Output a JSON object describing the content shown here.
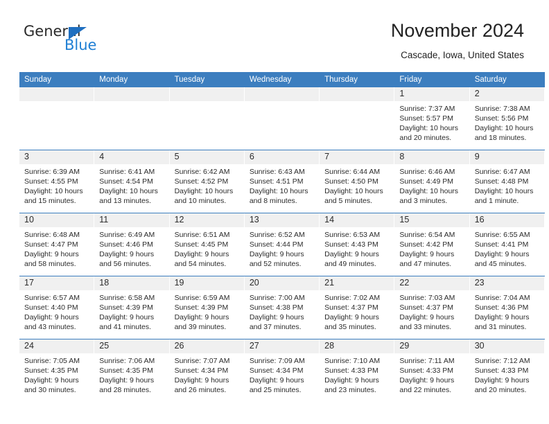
{
  "brand": {
    "name_top": "General",
    "name_bottom": "Blue",
    "triangle_icon": "triangle-icon",
    "accent_color": "#1f7fd4"
  },
  "header": {
    "title": "November 2024",
    "subtitle": "Cascade, Iowa, United States"
  },
  "theme": {
    "header_blue": "#3c7ebf",
    "daynum_gray": "#f0f0f0",
    "text": "#2b2b2b"
  },
  "weekday_headers": [
    "Sunday",
    "Monday",
    "Tuesday",
    "Wednesday",
    "Thursday",
    "Friday",
    "Saturday"
  ],
  "weeks": [
    [
      {
        "day": "",
        "sunrise": "",
        "sunset": "",
        "daylight_1": "",
        "daylight_2": ""
      },
      {
        "day": "",
        "sunrise": "",
        "sunset": "",
        "daylight_1": "",
        "daylight_2": ""
      },
      {
        "day": "",
        "sunrise": "",
        "sunset": "",
        "daylight_1": "",
        "daylight_2": ""
      },
      {
        "day": "",
        "sunrise": "",
        "sunset": "",
        "daylight_1": "",
        "daylight_2": ""
      },
      {
        "day": "",
        "sunrise": "",
        "sunset": "",
        "daylight_1": "",
        "daylight_2": ""
      },
      {
        "day": "1",
        "sunrise": "Sunrise: 7:37 AM",
        "sunset": "Sunset: 5:57 PM",
        "daylight_1": "Daylight: 10 hours",
        "daylight_2": "and 20 minutes."
      },
      {
        "day": "2",
        "sunrise": "Sunrise: 7:38 AM",
        "sunset": "Sunset: 5:56 PM",
        "daylight_1": "Daylight: 10 hours",
        "daylight_2": "and 18 minutes."
      }
    ],
    [
      {
        "day": "3",
        "sunrise": "Sunrise: 6:39 AM",
        "sunset": "Sunset: 4:55 PM",
        "daylight_1": "Daylight: 10 hours",
        "daylight_2": "and 15 minutes."
      },
      {
        "day": "4",
        "sunrise": "Sunrise: 6:41 AM",
        "sunset": "Sunset: 4:54 PM",
        "daylight_1": "Daylight: 10 hours",
        "daylight_2": "and 13 minutes."
      },
      {
        "day": "5",
        "sunrise": "Sunrise: 6:42 AM",
        "sunset": "Sunset: 4:52 PM",
        "daylight_1": "Daylight: 10 hours",
        "daylight_2": "and 10 minutes."
      },
      {
        "day": "6",
        "sunrise": "Sunrise: 6:43 AM",
        "sunset": "Sunset: 4:51 PM",
        "daylight_1": "Daylight: 10 hours",
        "daylight_2": "and 8 minutes."
      },
      {
        "day": "7",
        "sunrise": "Sunrise: 6:44 AM",
        "sunset": "Sunset: 4:50 PM",
        "daylight_1": "Daylight: 10 hours",
        "daylight_2": "and 5 minutes."
      },
      {
        "day": "8",
        "sunrise": "Sunrise: 6:46 AM",
        "sunset": "Sunset: 4:49 PM",
        "daylight_1": "Daylight: 10 hours",
        "daylight_2": "and 3 minutes."
      },
      {
        "day": "9",
        "sunrise": "Sunrise: 6:47 AM",
        "sunset": "Sunset: 4:48 PM",
        "daylight_1": "Daylight: 10 hours",
        "daylight_2": "and 1 minute."
      }
    ],
    [
      {
        "day": "10",
        "sunrise": "Sunrise: 6:48 AM",
        "sunset": "Sunset: 4:47 PM",
        "daylight_1": "Daylight: 9 hours",
        "daylight_2": "and 58 minutes."
      },
      {
        "day": "11",
        "sunrise": "Sunrise: 6:49 AM",
        "sunset": "Sunset: 4:46 PM",
        "daylight_1": "Daylight: 9 hours",
        "daylight_2": "and 56 minutes."
      },
      {
        "day": "12",
        "sunrise": "Sunrise: 6:51 AM",
        "sunset": "Sunset: 4:45 PM",
        "daylight_1": "Daylight: 9 hours",
        "daylight_2": "and 54 minutes."
      },
      {
        "day": "13",
        "sunrise": "Sunrise: 6:52 AM",
        "sunset": "Sunset: 4:44 PM",
        "daylight_1": "Daylight: 9 hours",
        "daylight_2": "and 52 minutes."
      },
      {
        "day": "14",
        "sunrise": "Sunrise: 6:53 AM",
        "sunset": "Sunset: 4:43 PM",
        "daylight_1": "Daylight: 9 hours",
        "daylight_2": "and 49 minutes."
      },
      {
        "day": "15",
        "sunrise": "Sunrise: 6:54 AM",
        "sunset": "Sunset: 4:42 PM",
        "daylight_1": "Daylight: 9 hours",
        "daylight_2": "and 47 minutes."
      },
      {
        "day": "16",
        "sunrise": "Sunrise: 6:55 AM",
        "sunset": "Sunset: 4:41 PM",
        "daylight_1": "Daylight: 9 hours",
        "daylight_2": "and 45 minutes."
      }
    ],
    [
      {
        "day": "17",
        "sunrise": "Sunrise: 6:57 AM",
        "sunset": "Sunset: 4:40 PM",
        "daylight_1": "Daylight: 9 hours",
        "daylight_2": "and 43 minutes."
      },
      {
        "day": "18",
        "sunrise": "Sunrise: 6:58 AM",
        "sunset": "Sunset: 4:39 PM",
        "daylight_1": "Daylight: 9 hours",
        "daylight_2": "and 41 minutes."
      },
      {
        "day": "19",
        "sunrise": "Sunrise: 6:59 AM",
        "sunset": "Sunset: 4:39 PM",
        "daylight_1": "Daylight: 9 hours",
        "daylight_2": "and 39 minutes."
      },
      {
        "day": "20",
        "sunrise": "Sunrise: 7:00 AM",
        "sunset": "Sunset: 4:38 PM",
        "daylight_1": "Daylight: 9 hours",
        "daylight_2": "and 37 minutes."
      },
      {
        "day": "21",
        "sunrise": "Sunrise: 7:02 AM",
        "sunset": "Sunset: 4:37 PM",
        "daylight_1": "Daylight: 9 hours",
        "daylight_2": "and 35 minutes."
      },
      {
        "day": "22",
        "sunrise": "Sunrise: 7:03 AM",
        "sunset": "Sunset: 4:37 PM",
        "daylight_1": "Daylight: 9 hours",
        "daylight_2": "and 33 minutes."
      },
      {
        "day": "23",
        "sunrise": "Sunrise: 7:04 AM",
        "sunset": "Sunset: 4:36 PM",
        "daylight_1": "Daylight: 9 hours",
        "daylight_2": "and 31 minutes."
      }
    ],
    [
      {
        "day": "24",
        "sunrise": "Sunrise: 7:05 AM",
        "sunset": "Sunset: 4:35 PM",
        "daylight_1": "Daylight: 9 hours",
        "daylight_2": "and 30 minutes."
      },
      {
        "day": "25",
        "sunrise": "Sunrise: 7:06 AM",
        "sunset": "Sunset: 4:35 PM",
        "daylight_1": "Daylight: 9 hours",
        "daylight_2": "and 28 minutes."
      },
      {
        "day": "26",
        "sunrise": "Sunrise: 7:07 AM",
        "sunset": "Sunset: 4:34 PM",
        "daylight_1": "Daylight: 9 hours",
        "daylight_2": "and 26 minutes."
      },
      {
        "day": "27",
        "sunrise": "Sunrise: 7:09 AM",
        "sunset": "Sunset: 4:34 PM",
        "daylight_1": "Daylight: 9 hours",
        "daylight_2": "and 25 minutes."
      },
      {
        "day": "28",
        "sunrise": "Sunrise: 7:10 AM",
        "sunset": "Sunset: 4:33 PM",
        "daylight_1": "Daylight: 9 hours",
        "daylight_2": "and 23 minutes."
      },
      {
        "day": "29",
        "sunrise": "Sunrise: 7:11 AM",
        "sunset": "Sunset: 4:33 PM",
        "daylight_1": "Daylight: 9 hours",
        "daylight_2": "and 22 minutes."
      },
      {
        "day": "30",
        "sunrise": "Sunrise: 7:12 AM",
        "sunset": "Sunset: 4:33 PM",
        "daylight_1": "Daylight: 9 hours",
        "daylight_2": "and 20 minutes."
      }
    ]
  ]
}
